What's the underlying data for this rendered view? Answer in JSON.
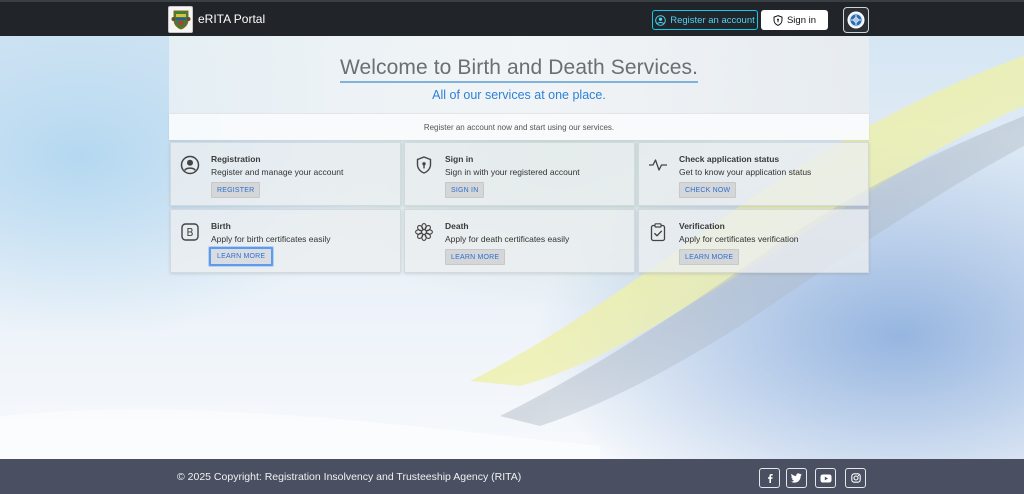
{
  "navbar": {
    "brand_title": "eRITA Portal",
    "register_label": "Register an account",
    "signin_label": "Sign in",
    "accent_color": "#0dcaf0",
    "background_color": "#212529"
  },
  "hero": {
    "title": "Welcome to Birth and Death Services.",
    "subtitle": "All of our services at one place.",
    "note": "Register an account now and start using our services."
  },
  "cards": [
    {
      "title": "Registration",
      "description": "Register and manage your account",
      "action": "REGISTER",
      "icon": "person-circle-icon"
    },
    {
      "title": "Sign in",
      "description": "Sign in with your registered account",
      "action": "SIGN IN",
      "icon": "shield-lock-icon"
    },
    {
      "title": "Check application status",
      "description": "Get to know your application status",
      "action": "CHECK NOW",
      "icon": "activity-icon"
    },
    {
      "title": "Birth",
      "description": "Apply for birth certificates easily",
      "action": "LEARN MORE",
      "icon": "letter-b-icon"
    },
    {
      "title": "Death",
      "description": "Apply for death certificates easily",
      "action": "LEARN MORE",
      "icon": "flower-icon"
    },
    {
      "title": "Verification",
      "description": "Apply for certificates verification",
      "action": "LEARN MORE",
      "icon": "clipboard-check-icon"
    }
  ],
  "footer": {
    "copyright": "© 2025 Copyright: Registration Insolvency and Trusteeship Agency (RITA)",
    "social": [
      "facebook-icon",
      "twitter-icon",
      "youtube-icon",
      "instagram-icon"
    ],
    "background_color": "#4a5062"
  }
}
